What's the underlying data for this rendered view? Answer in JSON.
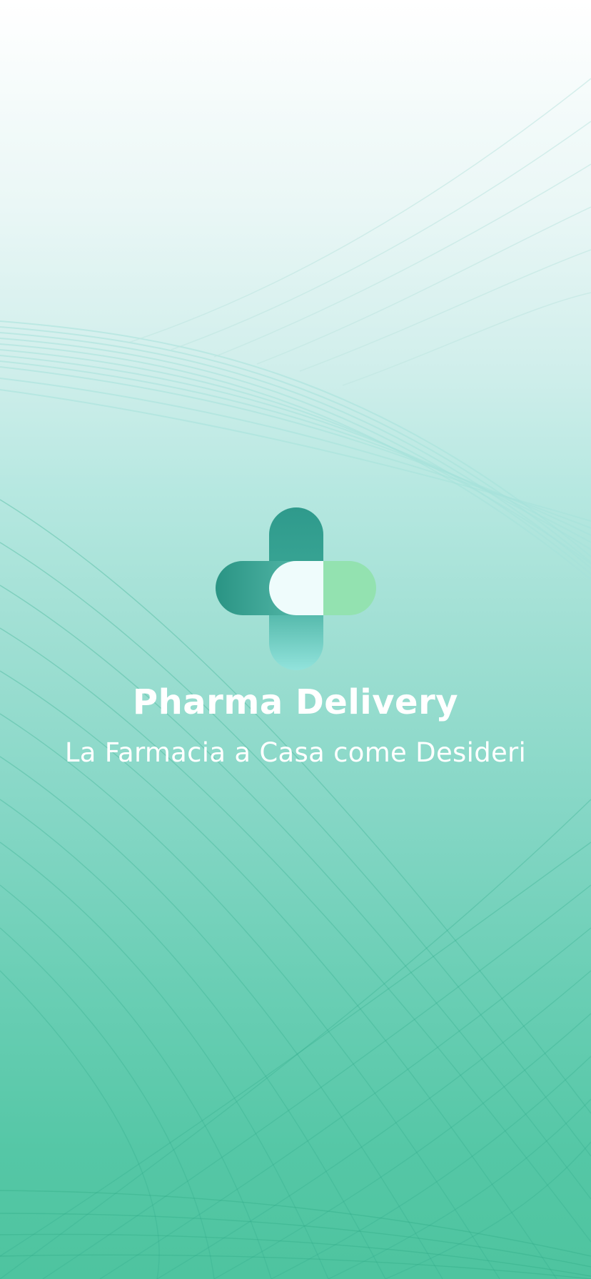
{
  "app": {
    "title": "Pharma Delivery",
    "tagline": "La Farmacia a Casa come Desideri"
  },
  "logo": {
    "icon": "pharmacy-cross-pill-icon",
    "colors": {
      "dark_teal": "#2a9a8c",
      "mid_teal": "#3aa796",
      "light_teal": "#8fe0d8",
      "mint": "#93e2b0",
      "pill_white": "#effcfc"
    }
  },
  "background": {
    "top_color": "#ffffff",
    "mid_color": "#9fdfd3",
    "bottom_color": "#4ec49f",
    "line_color": "#37b896"
  }
}
